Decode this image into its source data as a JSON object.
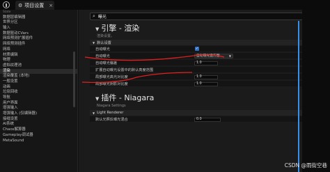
{
  "titlebar": {
    "tab_label": "项目设置"
  },
  "sidebar": {
    "items": [
      {
        "label": "Slate",
        "type": "small"
      },
      {
        "label": "数据层编辑器",
        "type": "normal"
      },
      {
        "label": "世界分区",
        "type": "normal"
      },
      {
        "label": "输入",
        "type": "normal"
      },
      {
        "label": "数据驱动CVars",
        "type": "normal"
      },
      {
        "label": "网络预测扩展插件",
        "type": "normal"
      },
      {
        "label": "网络预测插件",
        "type": "normal"
      },
      {
        "label": "网络",
        "type": "normal"
      },
      {
        "label": "材质编辑",
        "type": "normal"
      },
      {
        "label": "物理",
        "type": "normal"
      },
      {
        "label": "虚拟纹理池",
        "type": "normal"
      },
      {
        "label": "渲染",
        "type": "active"
      },
      {
        "label": "渲染覆盖 (本地)",
        "type": "normal"
      },
      {
        "label": "一般设置",
        "type": "normal"
      },
      {
        "label": "动画",
        "type": "normal"
      },
      {
        "label": "垃圾回收",
        "type": "normal"
      },
      {
        "label": "导航",
        "type": "normal"
      },
      {
        "label": "用户界面",
        "type": "normal"
      },
      {
        "label": "增强输入",
        "type": "normal"
      },
      {
        "label": "增强输入 (仅编辑器)",
        "type": "normal"
      },
      {
        "label": "接缝设置",
        "type": "normal"
      },
      {
        "label": "AI系统",
        "type": "normal"
      },
      {
        "label": "Chaos解算器",
        "type": "normal"
      },
      {
        "label": "Gameplay调试器",
        "type": "normal"
      },
      {
        "label": "MetaSound",
        "type": "normal"
      }
    ]
  },
  "search": {
    "value": "曝光"
  },
  "sections": {
    "engine": {
      "title": "引擎 - 渲染",
      "subtitle": "渲染设置。"
    },
    "plugin": {
      "title": "插件 - Niagara",
      "subtitle": "Niagara Settings"
    }
  },
  "categories": {
    "default": "默认设置",
    "light_renderer": "Light Renderer"
  },
  "rows": {
    "auto_exposure": "自动曝光",
    "auto_exposure_method": "自动曝光",
    "auto_exposure_method_value": "自动曝光直方图",
    "auto_exposure_bias": "自动曝光偏差",
    "auto_exposure_bias_value": "1.0",
    "extend_range": "扩展自动曝光设置中的默认亮度范围",
    "local_highlight": "局部曝光高光对比度",
    "local_highlight_value": "1.0",
    "local_shadow": "局部曝光阴影对比度",
    "local_shadow_value": "1.0",
    "default_light_inverse_exposure": "默认光照反曝光混合",
    "default_light_inverse_exposure_value": "0.0"
  },
  "watermark": "CSDN @雨街空巷",
  "colors": {
    "accent_blue": "#3a8fe8",
    "annotation_red": "#e02020"
  }
}
